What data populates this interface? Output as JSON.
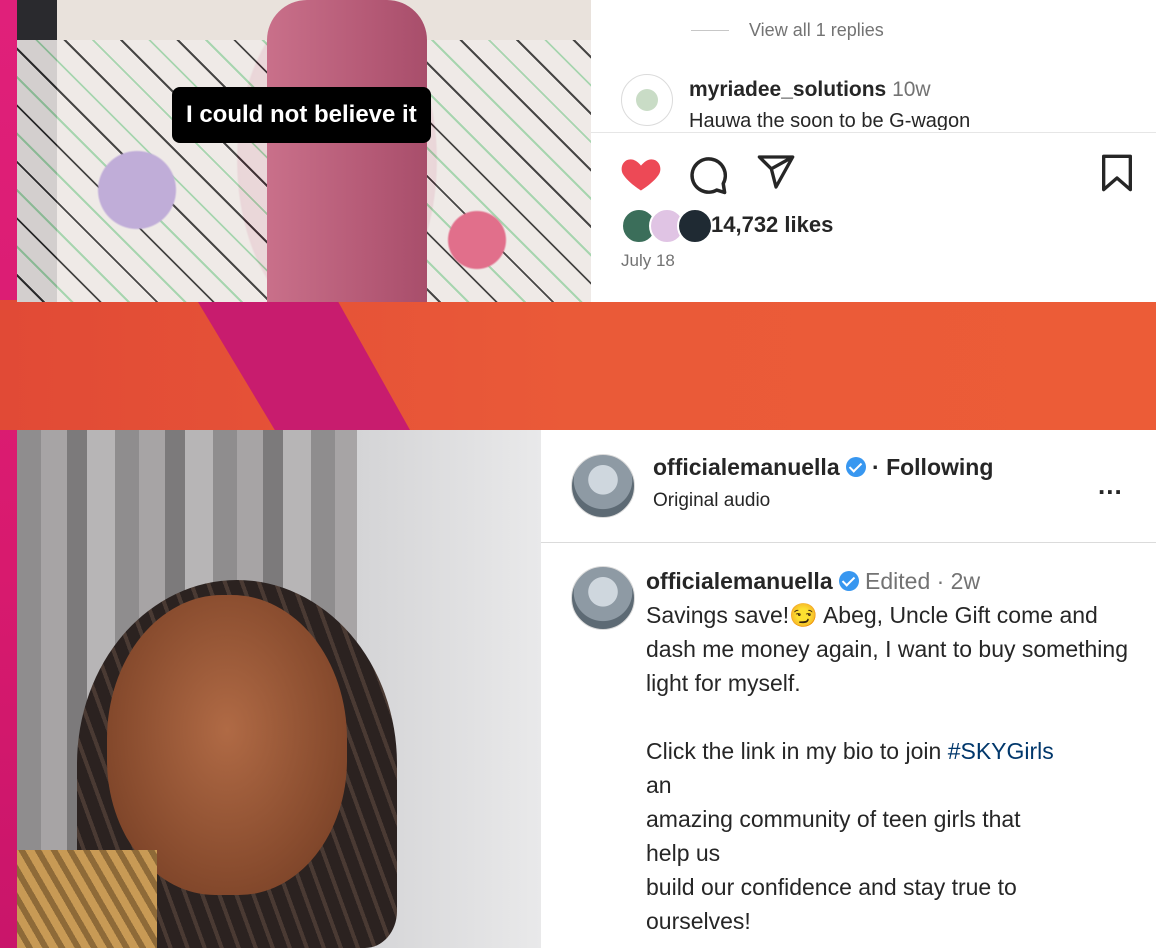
{
  "top": {
    "caption": "I could not believe it",
    "replies_label": "View all 1 replies",
    "comment": {
      "user": "myriadee_solutions",
      "time": "10w",
      "text": "Hauwa the soon to be G-wagon"
    },
    "likes": "14,732 likes",
    "date": "July 18",
    "colors": {
      "heart": "#ed4956"
    }
  },
  "bottom": {
    "header": {
      "user": "officialemanuella",
      "follow_status": "· Following",
      "subtitle": "Original audio",
      "more": "..."
    },
    "post": {
      "user": "officialemanuella",
      "meta": "Edited ·  2w",
      "line1": "Savings save!😏 Abeg, Uncle Gift come and dash me money again, I want to buy something light for myself.",
      "line2_prefix": "Click the link in my bio to join ",
      "hashtag": "#SKYGirls",
      "line3": "an",
      "line4": "amazing community of teen girls that",
      "line5": "help us",
      "line6": "build our confidence and stay true to",
      "line7": "ourselves!"
    }
  }
}
